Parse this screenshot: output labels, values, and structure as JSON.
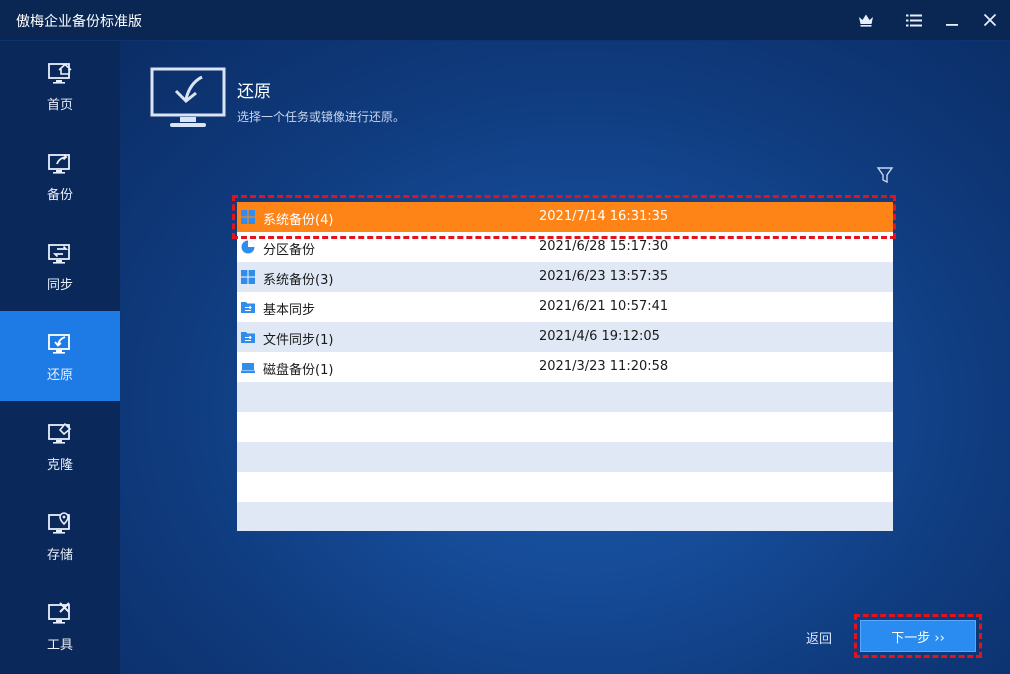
{
  "window": {
    "title": "傲梅企业备份标准版",
    "controls": [
      {
        "name": "crown-icon"
      },
      {
        "name": "menu-icon"
      },
      {
        "name": "minimize-icon"
      },
      {
        "name": "close-icon"
      }
    ]
  },
  "sidebar": {
    "items": [
      {
        "label": "首页",
        "icon": "home-monitor-icon",
        "active": false
      },
      {
        "label": "备份",
        "icon": "backup-monitor-icon",
        "active": false
      },
      {
        "label": "同步",
        "icon": "sync-monitor-icon",
        "active": false
      },
      {
        "label": "还原",
        "icon": "restore-monitor-icon",
        "active": true
      },
      {
        "label": "克隆",
        "icon": "clone-monitor-icon",
        "active": false
      },
      {
        "label": "存储",
        "icon": "storage-location-icon",
        "active": false
      },
      {
        "label": "工具",
        "icon": "tools-icon",
        "active": false
      }
    ]
  },
  "main": {
    "title": "还原",
    "subtitle": "选择一个任务或镜像进行还原。",
    "tasks": [
      {
        "name": "系统备份(4)",
        "time": "2021/7/14 16:31:35",
        "icon": "windows-icon",
        "selected": true
      },
      {
        "name": "分区备份",
        "time": "2021/6/28 15:17:30",
        "icon": "partition-pie-icon",
        "selected": false
      },
      {
        "name": "系统备份(3)",
        "time": "2021/6/23 13:57:35",
        "icon": "windows-icon",
        "selected": false
      },
      {
        "name": "基本同步",
        "time": "2021/6/21 10:57:41",
        "icon": "sync-folder-icon",
        "selected": false
      },
      {
        "name": "文件同步(1)",
        "time": "2021/4/6 19:12:05",
        "icon": "sync-folder-icon",
        "selected": false
      },
      {
        "name": "磁盘备份(1)",
        "time": "2021/3/23 11:20:58",
        "icon": "disk-icon",
        "selected": false
      }
    ],
    "back_label": "返回",
    "next_label": "下一步 ››"
  },
  "colors": {
    "selected_row": "#ff8418",
    "accent": "#1e7be6",
    "highlight_border": "#e3121b"
  }
}
